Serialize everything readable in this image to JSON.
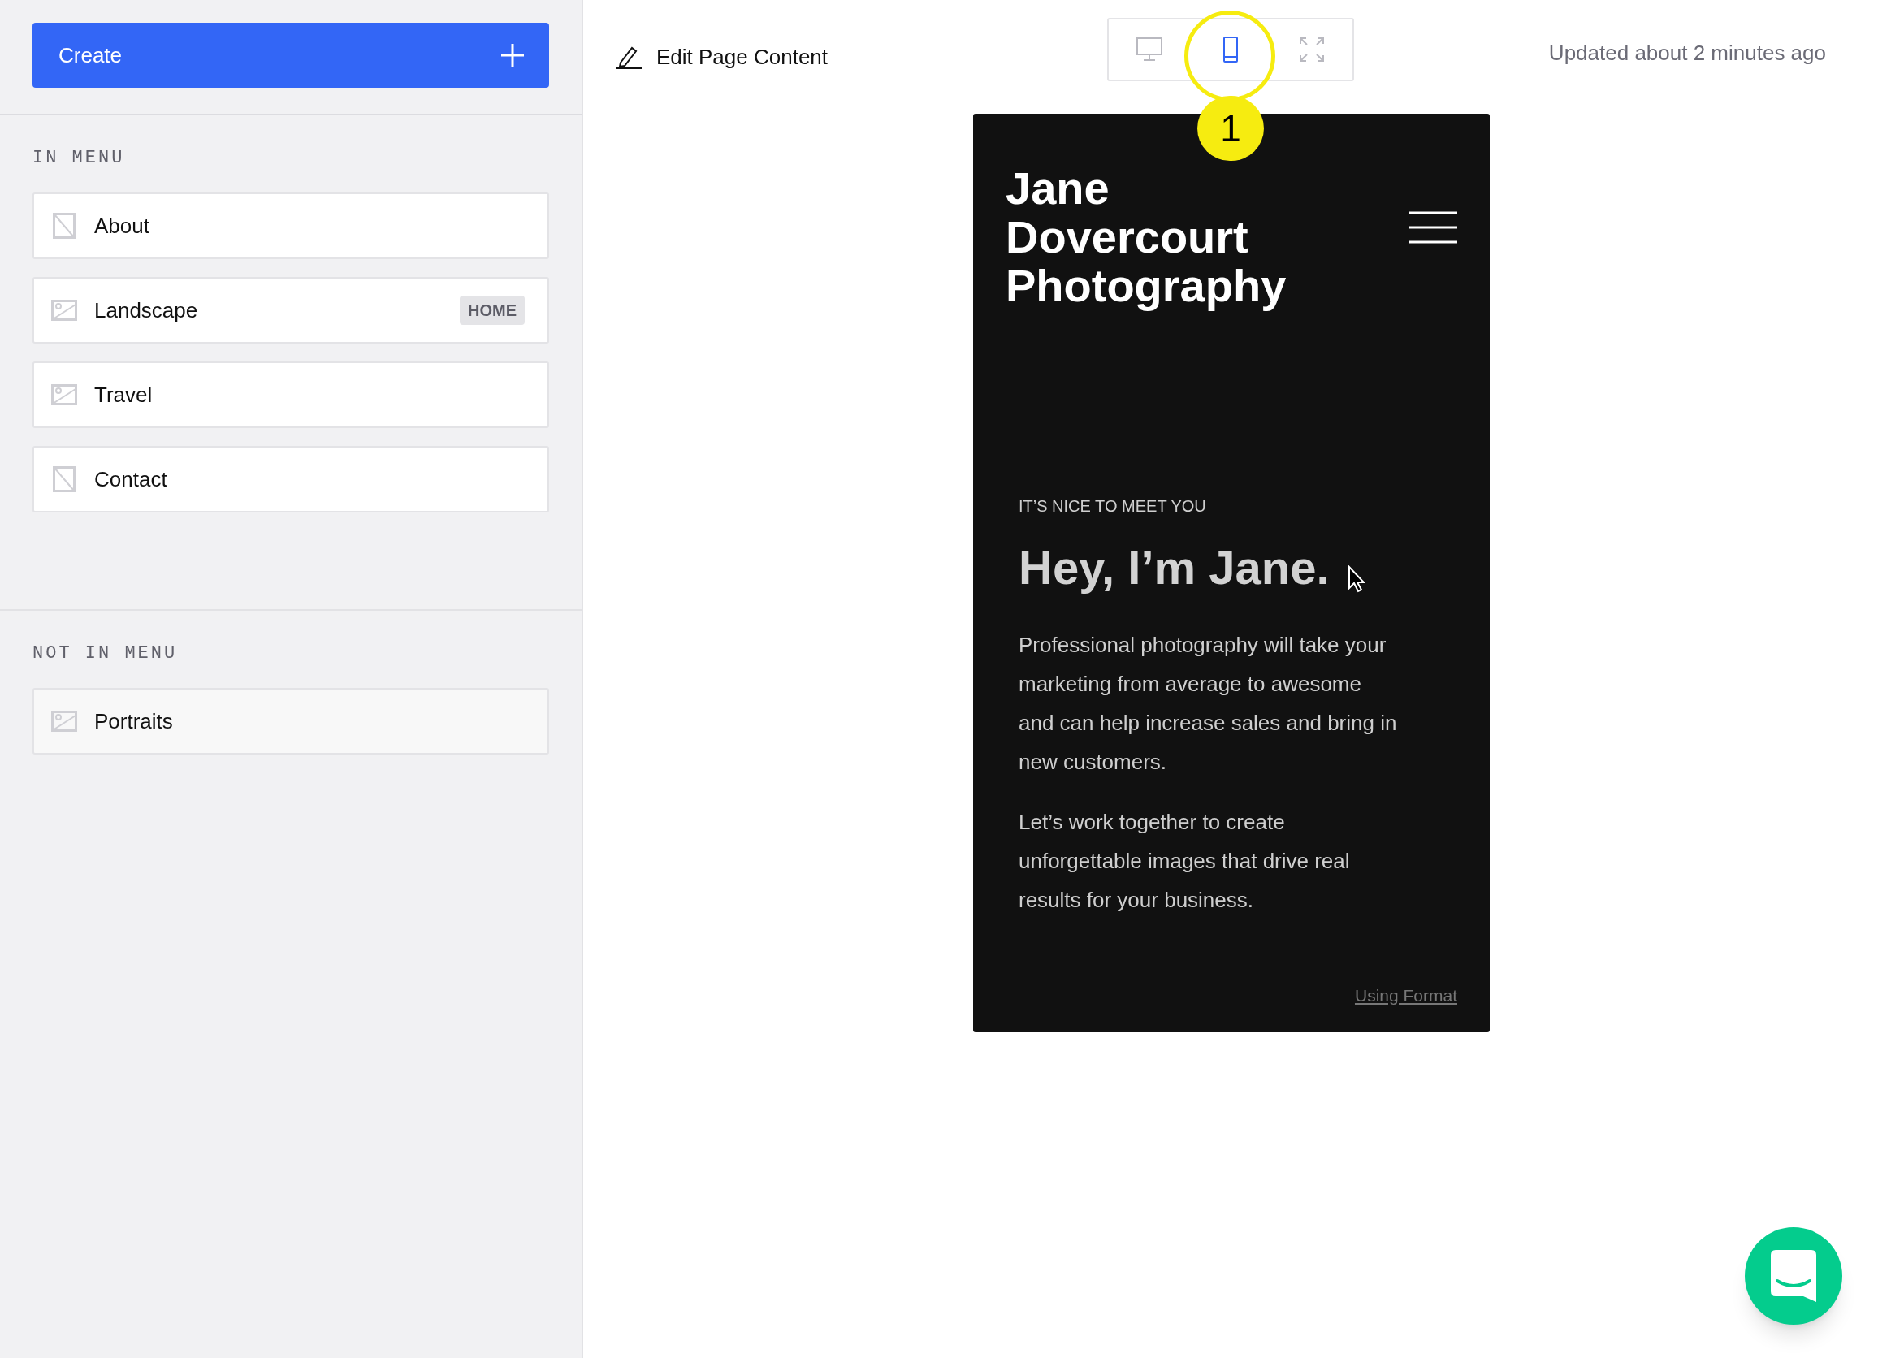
{
  "sidebar": {
    "create_button": {
      "label": "Create"
    },
    "sections": [
      {
        "title": "IN MENU",
        "items": [
          {
            "label": "About",
            "kind": "page"
          },
          {
            "label": "Landscape",
            "kind": "gallery",
            "badge": "HOME"
          },
          {
            "label": "Travel",
            "kind": "gallery"
          },
          {
            "label": "Contact",
            "kind": "page"
          }
        ]
      },
      {
        "title": "NOT IN MENU",
        "items": [
          {
            "label": "Portraits",
            "kind": "gallery"
          }
        ]
      }
    ]
  },
  "toolbar": {
    "edit_label": "Edit Page Content",
    "view_modes": [
      {
        "kind": "desktop",
        "selected": false
      },
      {
        "kind": "mobile",
        "selected": true
      },
      {
        "kind": "fullscreen",
        "selected": false
      }
    ],
    "updated": "Updated about 2 minutes ago"
  },
  "annotation": {
    "label": "1"
  },
  "preview": {
    "site_title": "Jane Dovercourt Photography",
    "eyebrow": "IT’S NICE TO MEET YOU",
    "heading": "Hey, I’m Jane.",
    "paragraphs": [
      "Professional photography will take your marketing from average to awesome and can help increase sales and bring in new customers.",
      "Let’s work together to create unforgettable images that drive real results for your business."
    ],
    "footer_link": "Using Format"
  }
}
